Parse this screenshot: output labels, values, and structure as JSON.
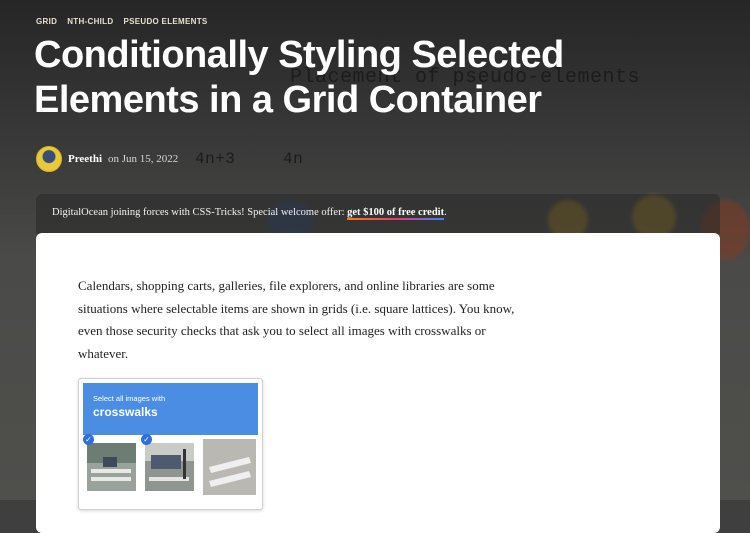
{
  "tags": [
    "GRID",
    "NTH-CHILD",
    "PSEUDO ELEMENTS"
  ],
  "title": "Conditionally Styling Selected Elements in a Grid Container",
  "background_text": {
    "caption": "Placement of pseudo-elements",
    "label_1": "4n+3",
    "label_2": "4n"
  },
  "byline": {
    "author": "Preethi",
    "date": "on Jun 15, 2022"
  },
  "promo": {
    "text": "DigitalOcean joining forces with CSS-Tricks! Special welcome offer: ",
    "link": "get $100 of free credit",
    "suffix": "."
  },
  "article": {
    "intro": "Calendars, shopping carts, galleries, file explorers, and online libraries are some situations where selectable items are shown in grids (i.e. square lattices). You know, even those security checks that ask you to select all images with crosswalks or whatever."
  },
  "captcha": {
    "prompt": "Select all images with",
    "keyword": "crosswalks"
  },
  "colors": {
    "captcha_blue": "#4a8de3",
    "check_blue": "#2f6fd6"
  }
}
